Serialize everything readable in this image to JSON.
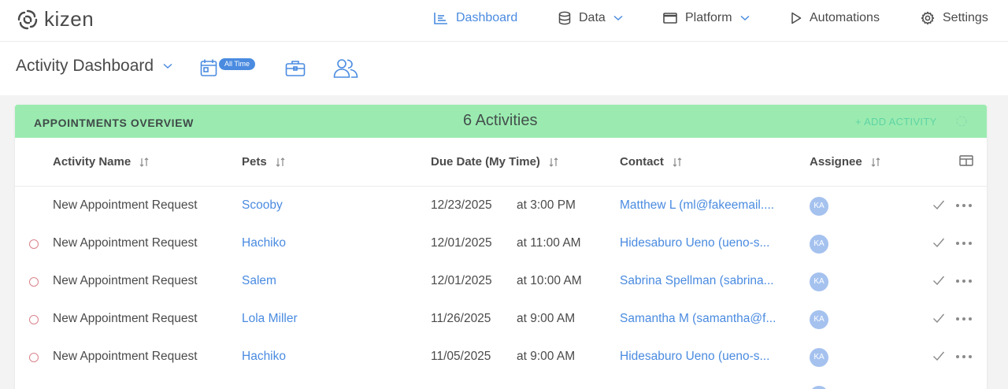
{
  "brand": {
    "name": "kizen"
  },
  "nav": {
    "dashboard": "Dashboard",
    "data": "Data",
    "platform": "Platform",
    "automations": "Automations",
    "settings": "Settings"
  },
  "subheader": {
    "title": "Activity Dashboard",
    "date_filter_badge": "All Time"
  },
  "card": {
    "title": "APPOINTMENTS OVERVIEW",
    "count": "6 Activities",
    "add_label": "+ ADD ACTIVITY",
    "columns": {
      "name": "Activity Name",
      "pets": "Pets",
      "due": "Due Date (My Time)",
      "contact": "Contact",
      "assignee": "Assignee"
    },
    "rows": [
      {
        "name": "New Appointment Request",
        "pet": "Scooby",
        "date": "12/23/2025",
        "time": "at 3:00 PM",
        "contact": "Matthew L (ml@fakeemail....",
        "assignee": "KA"
      },
      {
        "name": "New Appointment Request",
        "pet": "Hachiko",
        "date": "12/01/2025",
        "time": "at 11:00 AM",
        "contact": "Hidesaburo Ueno (ueno-s...",
        "assignee": "KA"
      },
      {
        "name": "New Appointment Request",
        "pet": "Salem",
        "date": "12/01/2025",
        "time": "at 10:00 AM",
        "contact": "Sabrina Spellman (sabrina...",
        "assignee": "KA"
      },
      {
        "name": "New Appointment Request",
        "pet": "Lola Miller",
        "date": "11/26/2025",
        "time": "at 9:00 AM",
        "contact": "Samantha M (samantha@f...",
        "assignee": "KA"
      },
      {
        "name": "New Appointment Request",
        "pet": "Hachiko",
        "date": "11/05/2025",
        "time": "at 9:00 AM",
        "contact": "Hidesaburo Ueno (ueno-s...",
        "assignee": "KA"
      }
    ]
  },
  "colors": {
    "accent": "#4a8be0",
    "header_green": "#9bebb0",
    "add_green": "#5fd4a4"
  }
}
